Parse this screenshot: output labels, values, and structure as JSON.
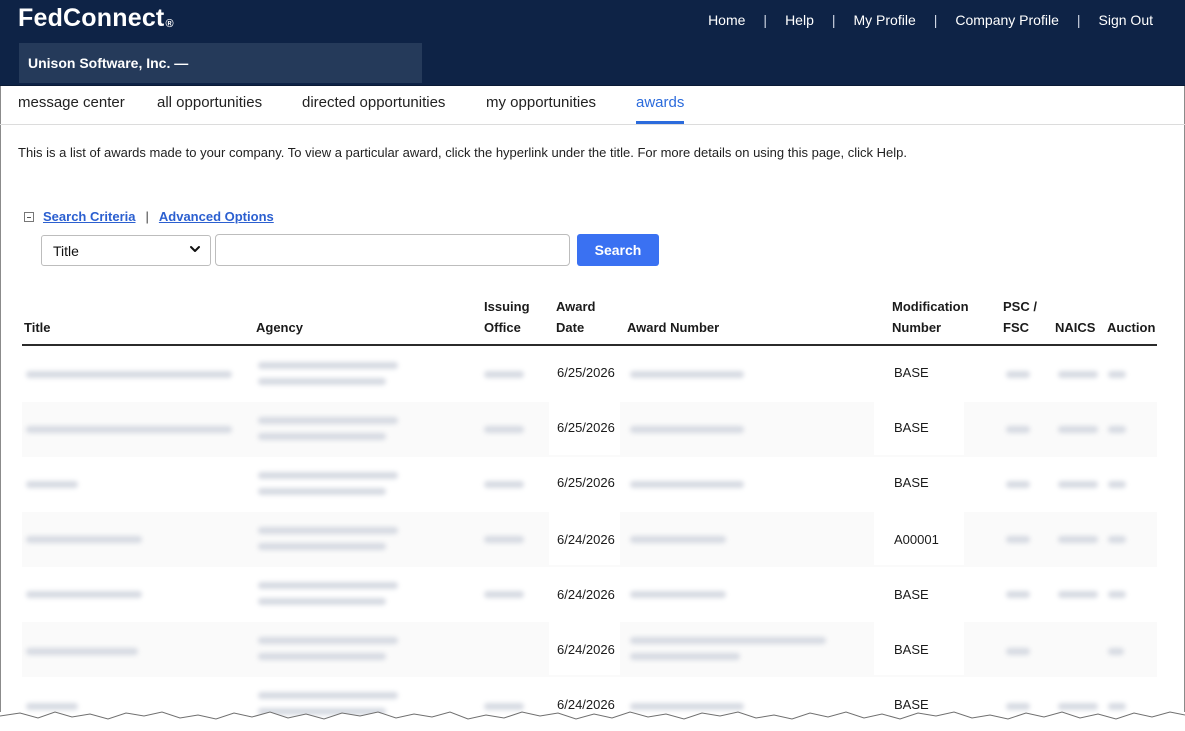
{
  "header": {
    "logo": "FedConnect",
    "logo_mark": "®",
    "links": [
      "Home",
      "Help",
      "My Profile",
      "Company Profile",
      "Sign Out"
    ],
    "company_name": "Unison Software, Inc. —"
  },
  "tabs": [
    {
      "label": "message center",
      "active": false
    },
    {
      "label": "all opportunities",
      "active": false
    },
    {
      "label": "directed opportunities",
      "active": false
    },
    {
      "label": "my opportunities",
      "active": false
    },
    {
      "label": "awards",
      "active": true
    }
  ],
  "intro": "This is a list of awards made to your company. To view a particular award, click the hyperlink under the title. For more details on using this page, click Help.",
  "search": {
    "criteria_label": "Search Criteria",
    "separator": "|",
    "advanced_label": "Advanced Options",
    "field_selected": "Title",
    "query_value": "",
    "button_label": "Search"
  },
  "table": {
    "headers": {
      "title": "Title",
      "agency": "Agency",
      "issuing_office": [
        "Issuing",
        "Office"
      ],
      "award_date": [
        "Award",
        "Date"
      ],
      "award_number": "Award Number",
      "modification_number": [
        "Modification",
        "Number"
      ],
      "psc_fsc": [
        "PSC /",
        "FSC"
      ],
      "naics": "NAICS",
      "auction": "Auction"
    },
    "rows": [
      {
        "award_date": "6/25/2026",
        "modification_number": "BASE"
      },
      {
        "award_date": "6/25/2026",
        "modification_number": "BASE"
      },
      {
        "award_date": "6/25/2026",
        "modification_number": "BASE"
      },
      {
        "award_date": "6/24/2026",
        "modification_number": "A00001"
      },
      {
        "award_date": "6/24/2026",
        "modification_number": "BASE"
      },
      {
        "award_date": "6/24/2026",
        "modification_number": "BASE"
      },
      {
        "award_date": "6/24/2026",
        "modification_number": "BASE"
      }
    ]
  },
  "colors": {
    "header_bg": "#0e2346",
    "company_bar": "#253a5a",
    "accent": "#2b6bdc",
    "button": "#3a71f2"
  },
  "icons": {
    "collapse": "minus-square-icon",
    "dropdown": "chevron-down-icon"
  }
}
